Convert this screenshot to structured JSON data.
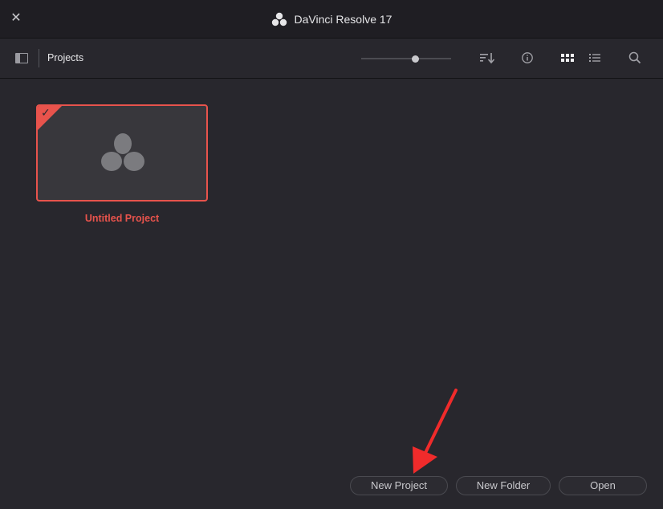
{
  "window": {
    "title": "DaVinci Resolve 17",
    "close_icon": "close-icon",
    "logo_icon": "davinci-logo-icon"
  },
  "toolbar": {
    "breadcrumb": "Projects",
    "thumbnail_size": 0.6,
    "icons": [
      "sidebar-toggle-icon",
      "sort-icon",
      "info-icon",
      "grid-view-icon",
      "list-view-icon",
      "search-icon"
    ]
  },
  "projects": [
    {
      "name": "Untitled Project",
      "selected": true
    }
  ],
  "actions": {
    "new_project": "New Project",
    "new_folder": "New Folder",
    "open": "Open"
  },
  "colors": {
    "accent": "#e8534c",
    "background": "#28272d",
    "annotation_arrow": "#f02b2b"
  }
}
